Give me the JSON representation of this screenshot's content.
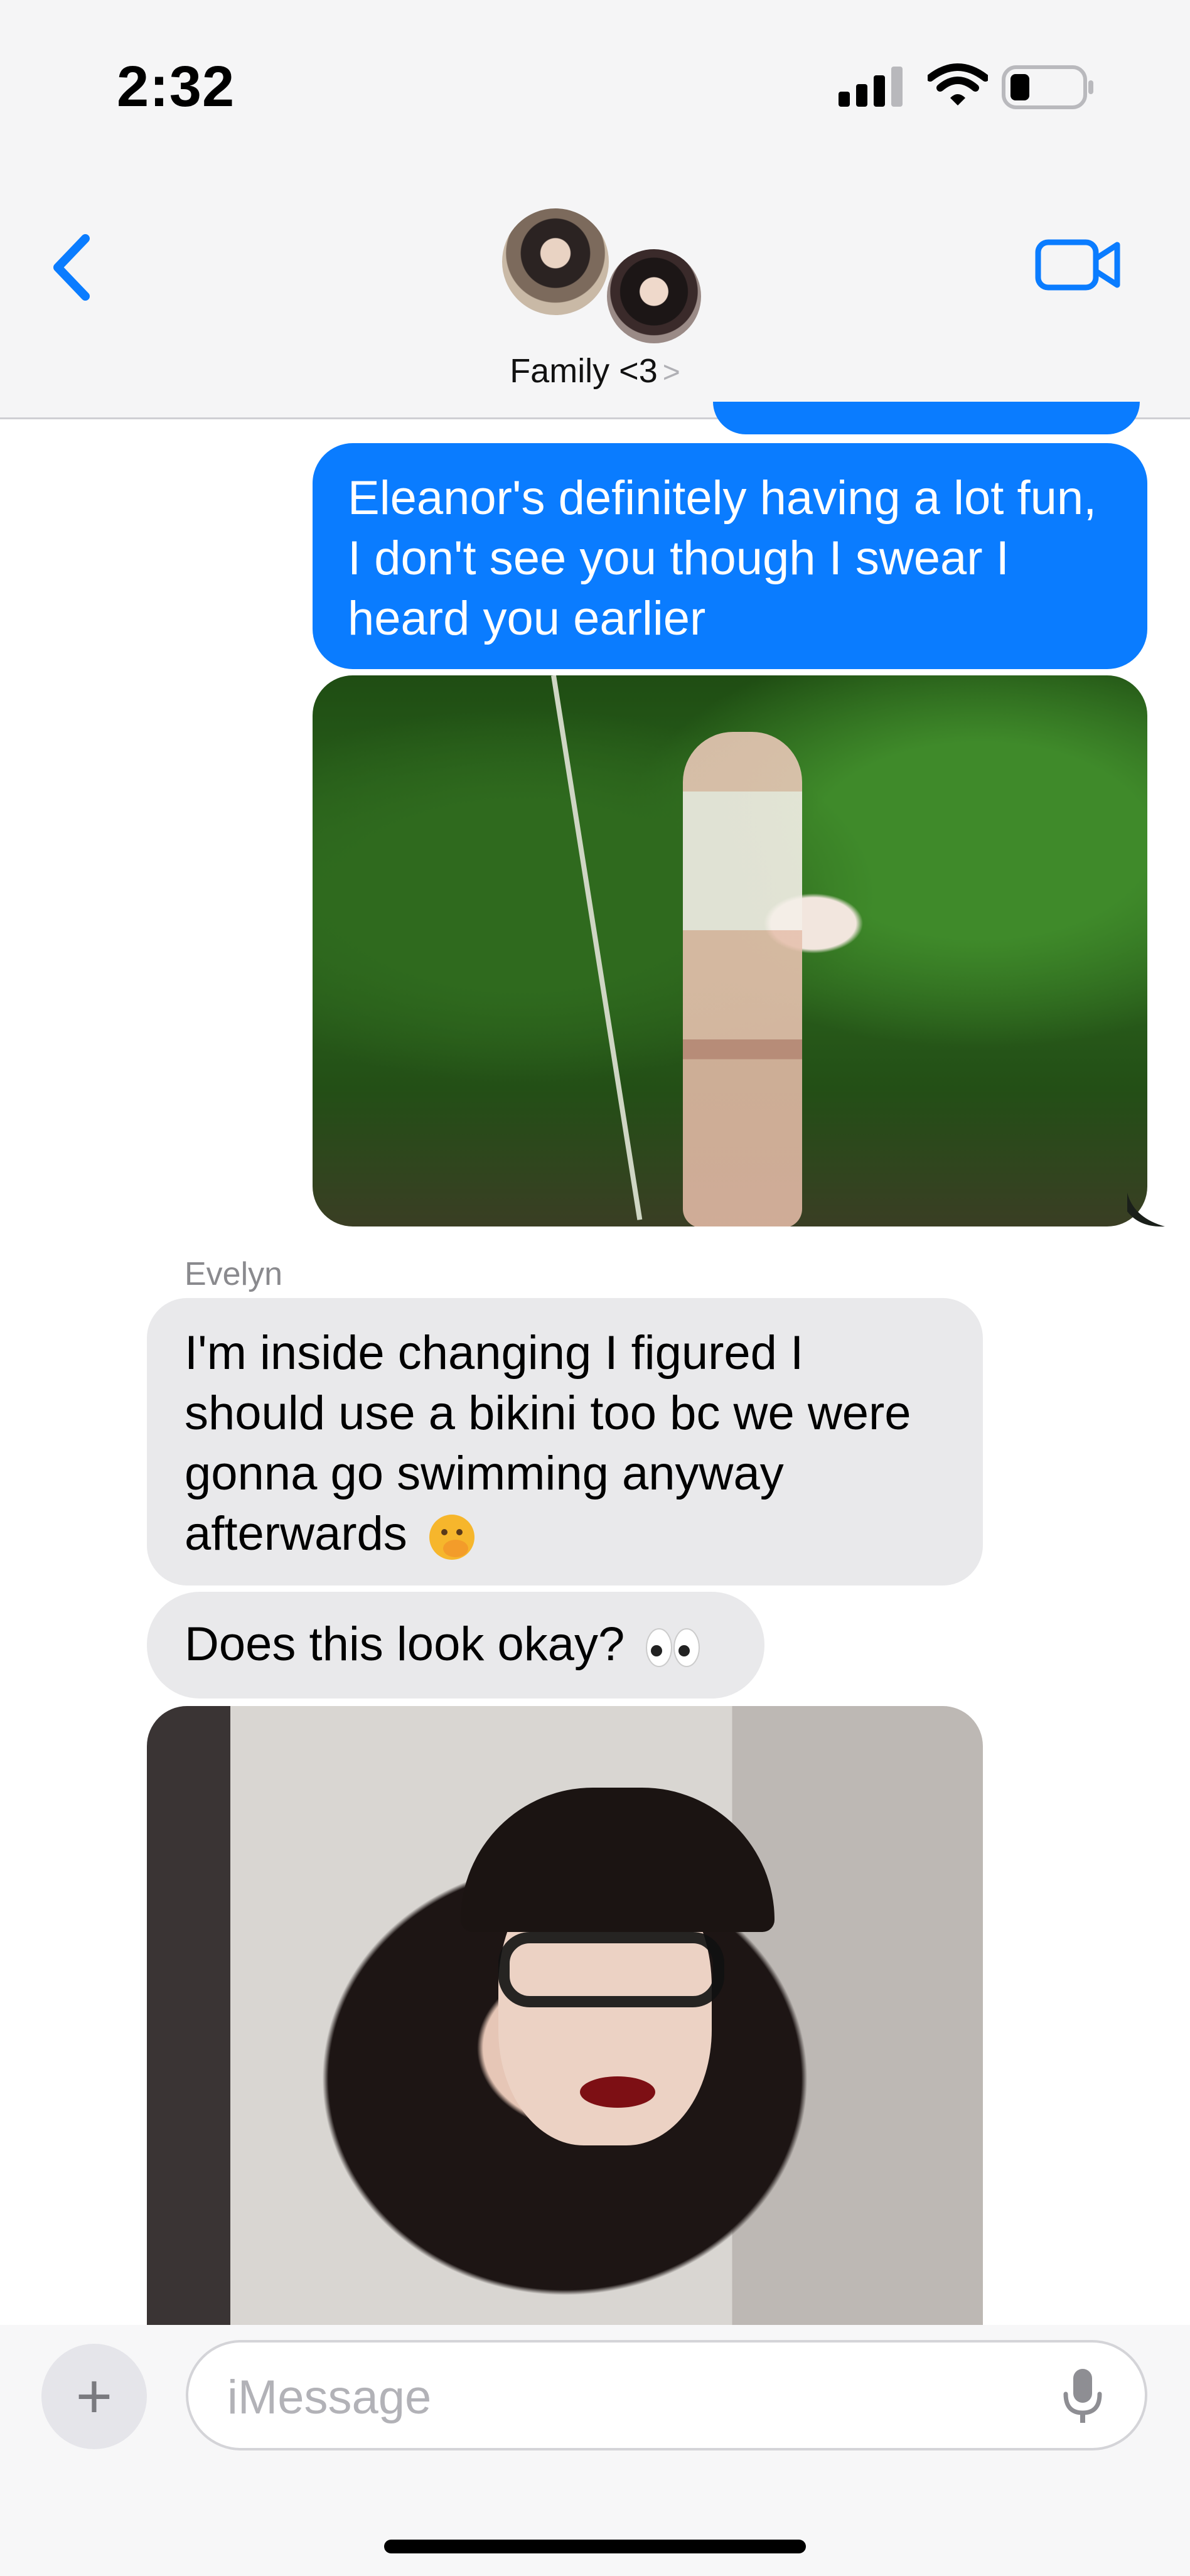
{
  "status_bar": {
    "time": "2:32",
    "icons": [
      "cellular-signal-icon",
      "wifi-icon",
      "battery-icon"
    ]
  },
  "nav": {
    "back_icon": "chevron-left-icon",
    "group_name": "Family <3",
    "group_chevron": ">",
    "video_icon": "video-camera-icon",
    "accent_color": "#0a7cff"
  },
  "messages": [
    {
      "direction": "outgoing",
      "text": "Eleanor's definitely having a lot fun, I don't see you though I swear I heard you earlier"
    },
    {
      "direction": "outgoing",
      "type": "photo"
    },
    {
      "direction": "incoming",
      "sender": "Evelyn",
      "text": "I'm inside changing I figured I should use a bikini too bc we were gonna go swimming anyway afterwards",
      "emoji": "face-with-hand-over-mouth"
    },
    {
      "direction": "incoming",
      "text": "Does this look okay?",
      "emoji": "eyes"
    },
    {
      "direction": "incoming",
      "type": "photo"
    }
  ],
  "composer": {
    "plus_label": "+",
    "placeholder": "iMessage",
    "mic_icon": "microphone-icon"
  },
  "colors": {
    "outgoing_bubble": "#0a7cff",
    "incoming_bubble": "#e9e9eb"
  }
}
